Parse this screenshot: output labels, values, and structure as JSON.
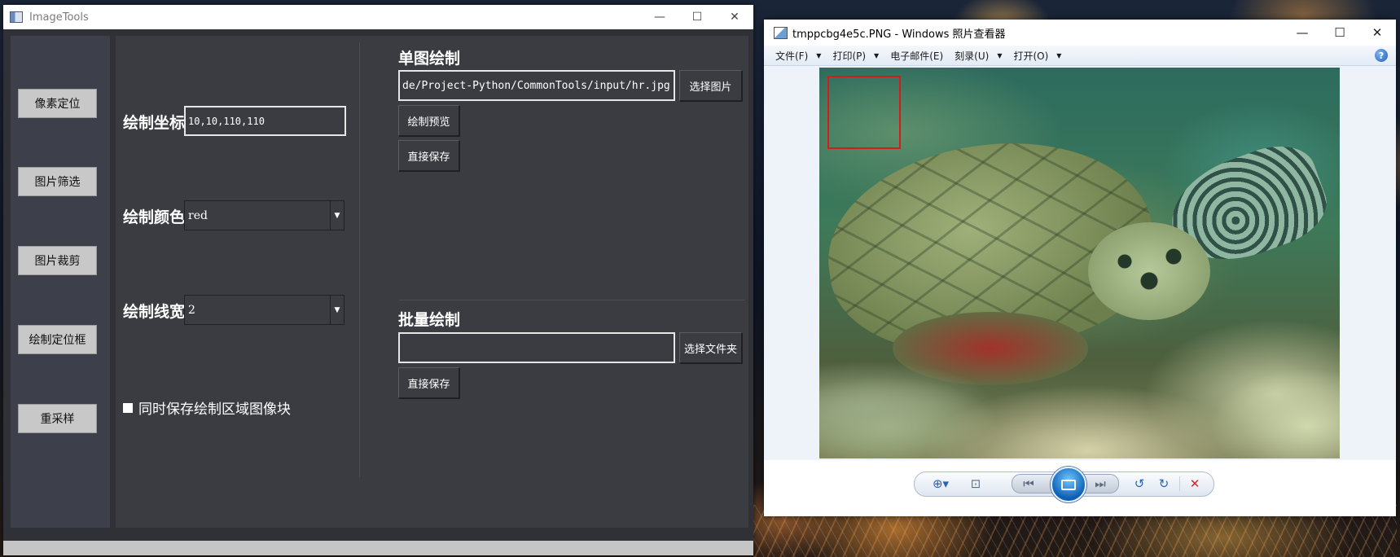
{
  "window1": {
    "title": "ImageTools",
    "controls": {
      "minimize": "—",
      "maximize": "☐",
      "close": "✕"
    }
  },
  "sidebar": {
    "buttons": [
      {
        "label": "像素定位"
      },
      {
        "label": "图片筛选"
      },
      {
        "label": "图片裁剪"
      },
      {
        "label": "绘制定位框"
      },
      {
        "label": "重采样"
      }
    ]
  },
  "draw_settings": {
    "coord_label": "绘制坐标",
    "coord_value": "10,10,110,110",
    "color_label": "绘制颜色",
    "color_value": "red",
    "width_label": "绘制线宽",
    "width_value": "2",
    "save_patch_label": "同时保存绘制区域图像块",
    "save_patch_checked": true
  },
  "single_draw": {
    "title": "单图绘制",
    "path_value": "de/Project-Python/CommonTools/input/hr.jpg",
    "select_button": "选择图片",
    "preview_button": "绘制预览",
    "save_button": "直接保存"
  },
  "batch_draw": {
    "title": "批量绘制",
    "folder_value": "",
    "select_button": "选择文件夹",
    "save_button": "直接保存"
  },
  "window2": {
    "title": "tmppcbg4e5c.PNG - Windows 照片查看器",
    "controls": {
      "minimize": "—",
      "maximize": "☐",
      "close": "✕"
    },
    "menu": [
      {
        "label": "文件(F)",
        "caret": "▼"
      },
      {
        "label": "打印(P)",
        "caret": "▼"
      },
      {
        "label": "电子邮件(E)",
        "caret": ""
      },
      {
        "label": "刻录(U)",
        "caret": "▼"
      },
      {
        "label": "打开(O)",
        "caret": "▼"
      }
    ],
    "help_icon": "?",
    "toolbar": {
      "zoom": "⊕▾",
      "fit": "⊡",
      "prev": "⏮",
      "next": "⏭",
      "rotate_ccw": "↺",
      "rotate_cw": "↻",
      "delete": "✕"
    },
    "colors": {
      "draw_box": "#d41c1c",
      "delete": "#d22626"
    }
  }
}
